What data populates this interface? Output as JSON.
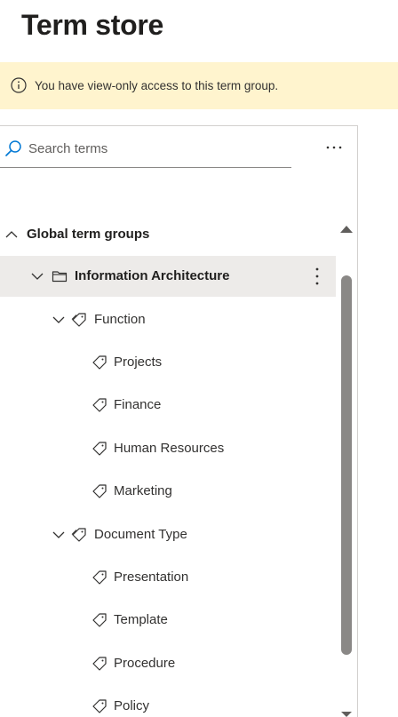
{
  "header": {
    "title": "Term store"
  },
  "banner": {
    "message": "You have view-only access to this term group.",
    "icon": "info-icon"
  },
  "search": {
    "placeholder": "Search terms",
    "value": ""
  },
  "toolbar": {
    "more_icon": "more-horizontal-icon"
  },
  "tree": {
    "root": {
      "label": "Global term groups",
      "expanded": true
    },
    "group": {
      "label": "Information Architecture",
      "expanded": true,
      "selected": true
    },
    "term_sets": [
      {
        "label": "Function",
        "expanded": true,
        "terms": [
          "Projects",
          "Finance",
          "Human Resources",
          "Marketing"
        ]
      },
      {
        "label": "Document Type",
        "expanded": true,
        "terms": [
          "Presentation",
          "Template",
          "Procedure",
          "Policy"
        ]
      }
    ]
  },
  "colors": {
    "banner_bg": "#fff4ce",
    "selected_row": "#edebe9",
    "search_icon": "#0078d4",
    "scroll_thumb": "#8a8886"
  }
}
